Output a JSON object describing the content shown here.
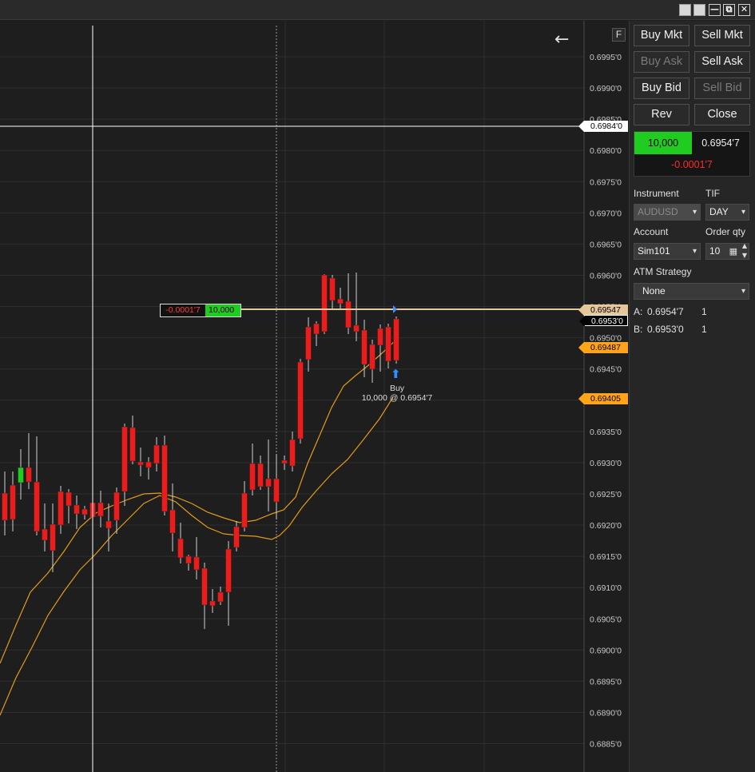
{
  "window": {
    "controls": {
      "minimize": "—",
      "restore": "⧉",
      "close": "✕"
    }
  },
  "chart": {
    "f_button": "F",
    "back_icon": "arrow-left-icon",
    "axis_ticks": [
      "0.6995'0",
      "0.6990'0",
      "0.6985'0",
      "0.6980'0",
      "0.6975'0",
      "0.6970'0",
      "0.6965'0",
      "0.6960'0",
      "0.6955'0",
      "0.6950'0",
      "0.6945'0",
      "0.6940'0",
      "0.6935'0",
      "0.6930'0",
      "0.6925'0",
      "0.6920'0",
      "0.6915'0",
      "0.6910'0",
      "0.6905'0",
      "0.6900'0",
      "0.6895'0",
      "0.6890'0",
      "0.6885'0"
    ],
    "price_tags": {
      "crosshair": "0.6984'0",
      "position": "0.69547",
      "last": "0.6953'0",
      "ema_fast": "0.69487",
      "ema_slow": "0.69405"
    },
    "position_box": {
      "pnl": "-0.0001'7",
      "qty": "10,000"
    },
    "fill": {
      "side": "Buy",
      "detail": "10,000 @ 0.6954'7"
    },
    "colors": {
      "up": "#1fcc1f",
      "down": "#ee1b1b",
      "ema": "#e39a1b",
      "position_line": "#e6c79c",
      "crosshair": "#ffffff"
    }
  },
  "panel": {
    "buttons": {
      "buy_mkt": "Buy Mkt",
      "sell_mkt": "Sell Mkt",
      "buy_ask": "Buy Ask",
      "sell_ask": "Sell Ask",
      "buy_bid": "Buy Bid",
      "sell_bid": "Sell Bid",
      "rev": "Rev",
      "close": "Close"
    },
    "position": {
      "qty": "10,000",
      "avg_price": "0.6954'7",
      "pnl": "-0.0001'7"
    },
    "instrument_label": "Instrument",
    "instrument_value": "AUDUSD",
    "tif_label": "TIF",
    "tif_value": "DAY",
    "account_label": "Account",
    "account_value": "Sim101",
    "order_qty_label": "Order qty",
    "order_qty_value": "10",
    "atm_label": "ATM Strategy",
    "atm_value": "None",
    "ask_label": "A:",
    "ask_price": "0.6954'7",
    "ask_size": "1",
    "bid_label": "B:",
    "bid_price": "0.6953'0",
    "bid_size": "1"
  }
}
